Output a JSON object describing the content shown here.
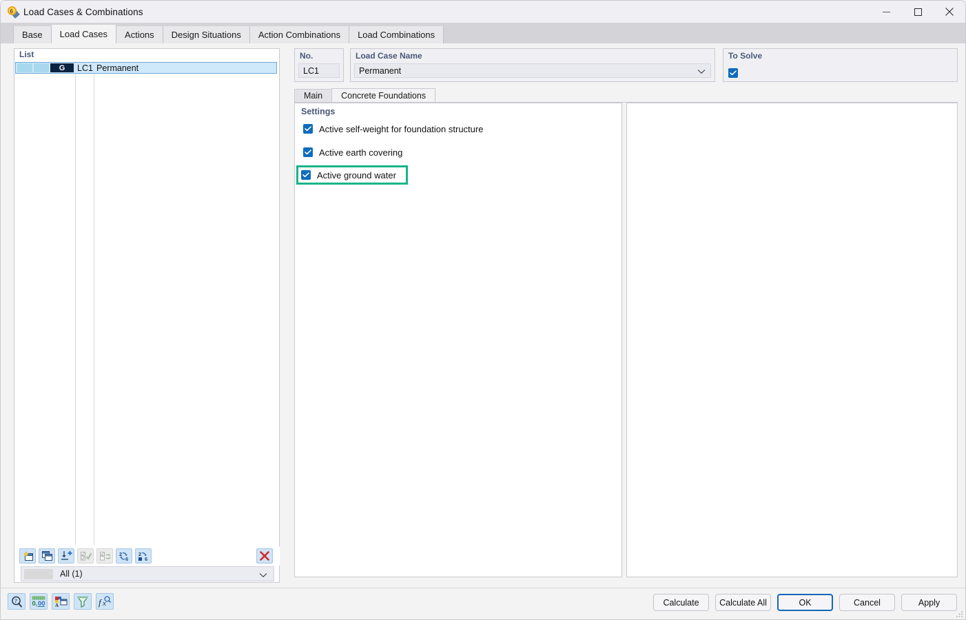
{
  "window": {
    "title": "Load Cases & Combinations",
    "icon": "load-case-icon",
    "controls": {
      "minimize": "minimize-icon",
      "maximize": "maximize-icon",
      "close": "close-icon"
    }
  },
  "outer_tabs": [
    {
      "label": "Base",
      "active": false
    },
    {
      "label": "Load Cases",
      "active": true
    },
    {
      "label": "Actions",
      "active": false
    },
    {
      "label": "Design Situations",
      "active": false
    },
    {
      "label": "Action Combinations",
      "active": false
    },
    {
      "label": "Load Combinations",
      "active": false
    }
  ],
  "list": {
    "header": "List",
    "rows": [
      {
        "tag": "G",
        "no": "LC1",
        "name": "Permanent",
        "selected": true
      }
    ],
    "toolbar": [
      {
        "name": "new-load-case-button",
        "enabled": true
      },
      {
        "name": "copy-load-case-button",
        "enabled": true
      },
      {
        "name": "import-load-case-button",
        "enabled": true
      },
      {
        "name": "select-all-button",
        "enabled": false
      },
      {
        "name": "invert-selection-button",
        "enabled": false
      },
      {
        "name": "renumber-button",
        "enabled": true
      },
      {
        "name": "renumber-single-button",
        "enabled": true
      }
    ],
    "delete_button": "delete-icon",
    "filter": {
      "value": "All (1)",
      "chevron": "chevron-down-icon"
    }
  },
  "details": {
    "no": {
      "label": "No.",
      "value": "LC1"
    },
    "load_case_name": {
      "label": "Load Case Name",
      "value": "Permanent",
      "chevron": "chevron-down-icon"
    },
    "to_solve": {
      "label": "To Solve",
      "checked": true
    }
  },
  "inner_tabs": [
    {
      "label": "Main",
      "active": false
    },
    {
      "label": "Concrete Foundations",
      "active": true
    }
  ],
  "settings": {
    "title": "Settings",
    "options": [
      {
        "label": "Active self-weight for foundation structure",
        "checked": true,
        "highlighted": false
      },
      {
        "label": "Active earth covering",
        "checked": true,
        "highlighted": false
      },
      {
        "label": "Active ground water",
        "checked": true,
        "highlighted": true
      }
    ]
  },
  "status_icons": [
    {
      "name": "help-search-icon"
    },
    {
      "name": "decimal-places-icon",
      "text": "0,00"
    },
    {
      "name": "display-properties-icon"
    },
    {
      "name": "filter-icon"
    },
    {
      "name": "formula-icon",
      "text": "f"
    }
  ],
  "dialog_buttons": [
    {
      "label": "Calculate",
      "primary": false
    },
    {
      "label": "Calculate All",
      "primary": false
    },
    {
      "label": "OK",
      "primary": true
    },
    {
      "label": "Cancel",
      "primary": false
    },
    {
      "label": "Apply",
      "primary": false
    }
  ],
  "colors": {
    "accent_blue": "#0f6cbd",
    "highlight_green": "#18b48a",
    "selection_blue": "#cfe8fa",
    "tag_navy": "#0a2340",
    "label_blue": "#4a5878",
    "delete_red": "#d42c2c"
  }
}
